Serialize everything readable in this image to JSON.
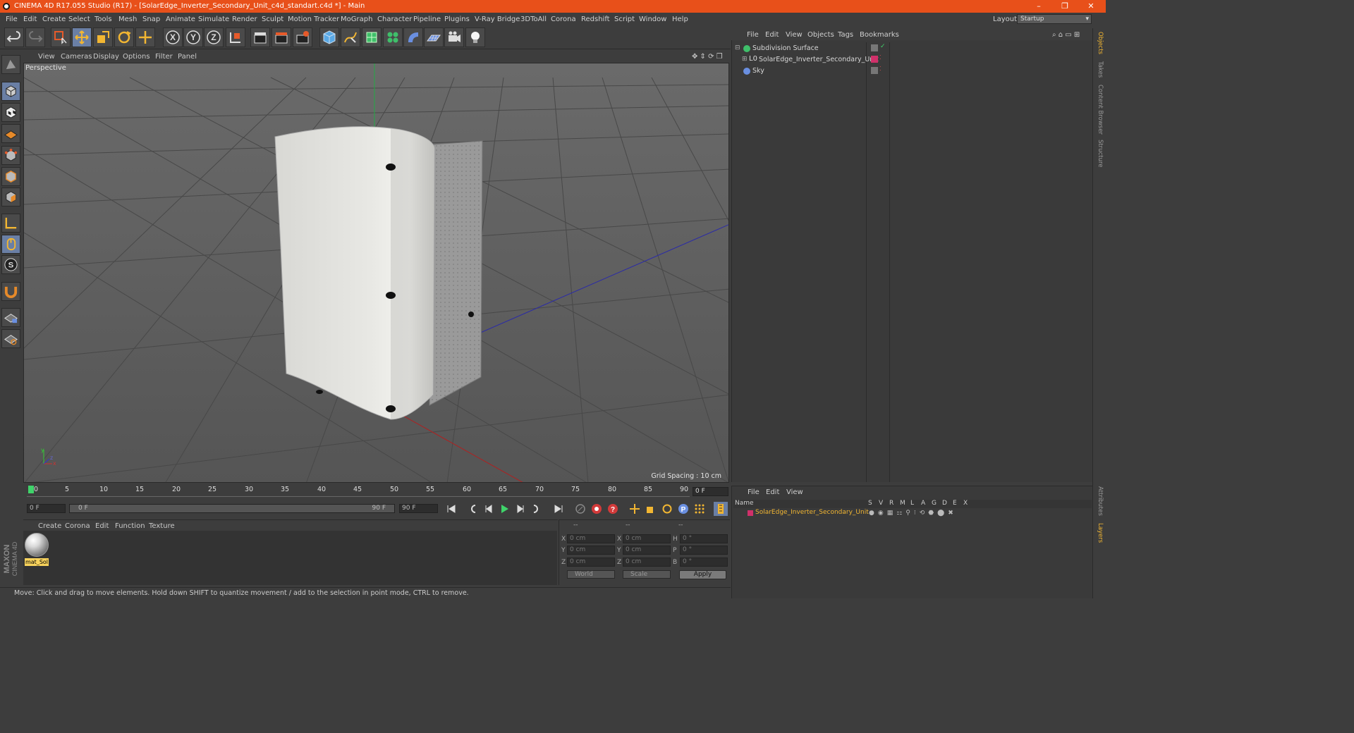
{
  "titlebar": {
    "title": "CINEMA 4D R17.055 Studio (R17) - [SolarEdge_Inverter_Secondary_Unit_c4d_standart.c4d *] - Main",
    "minimize": "–",
    "restore": "❐",
    "close": "✕"
  },
  "menu": [
    "File",
    "Edit",
    "Create",
    "Select",
    "Tools",
    "Mesh",
    "Snap",
    "Animate",
    "Simulate",
    "Render",
    "Sculpt",
    "Motion Tracker",
    "MoGraph",
    "Character",
    "Pipeline",
    "Plugins",
    "V-Ray Bridge",
    "3DToAll",
    "Corona",
    "Redshift",
    "Script",
    "Window",
    "Help"
  ],
  "layout": {
    "label": "Layout:",
    "value": "Startup"
  },
  "viewport": {
    "menu": [
      "View",
      "Cameras",
      "Display",
      "Options",
      "Filter",
      "Panel"
    ],
    "label": "Perspective",
    "grid_spacing": "Grid Spacing : 10 cm",
    "axis_x": "x",
    "axis_y": "y",
    "axis_z": "z"
  },
  "timeline": {
    "ticks": [
      "0",
      "5",
      "10",
      "15",
      "20",
      "25",
      "30",
      "35",
      "40",
      "45",
      "50",
      "55",
      "60",
      "65",
      "70",
      "75",
      "80",
      "85",
      "90"
    ],
    "current_frame": "0 F",
    "start_field": "0 F",
    "range_start": "0 F",
    "range_end": "90 F",
    "end_field": "90 F"
  },
  "material_manager": {
    "menu": [
      "Create",
      "Corona",
      "Edit",
      "Function",
      "Texture"
    ],
    "material_name": "mat_Sol",
    "brand_line1": "MAXON",
    "brand_line2": "CINEMA 4D"
  },
  "coordinates": {
    "headers": [
      "--",
      "--",
      "--"
    ],
    "rows": [
      {
        "l1": "X",
        "v1": "0 cm",
        "l2": "X",
        "v2": "0 cm",
        "l3": "H",
        "v3": "0 °"
      },
      {
        "l1": "Y",
        "v1": "0 cm",
        "l2": "Y",
        "v2": "0 cm",
        "l3": "P",
        "v3": "0 °"
      },
      {
        "l1": "Z",
        "v1": "0 cm",
        "l2": "Z",
        "v2": "0 cm",
        "l3": "B",
        "v3": "0 °"
      }
    ],
    "mode": "World",
    "transform": "Scale",
    "apply": "Apply"
  },
  "status": "Move: Click and drag to move elements. Hold down SHIFT to quantize movement / add to the selection in point mode, CTRL to remove.",
  "objects": {
    "menu": [
      "File",
      "Edit",
      "View",
      "Objects",
      "Tags",
      "Bookmarks"
    ],
    "items": [
      {
        "name": "Subdivision Surface"
      },
      {
        "name": "SolarEdge_Inverter_Secondary_Unit"
      },
      {
        "name": "Sky"
      }
    ]
  },
  "layers": {
    "menu": [
      "File",
      "Edit",
      "View"
    ],
    "columns": [
      "Name",
      "S",
      "V",
      "R",
      "M",
      "L",
      "A",
      "G",
      "D",
      "E",
      "X"
    ],
    "row_name": "SolarEdge_Inverter_Secondary_Unit"
  },
  "right_tabs": [
    "Objects",
    "Takes",
    "Content Browser",
    "Structure",
    "Attributes",
    "Layers"
  ],
  "colors": {
    "titlebar": "#e8501a",
    "accent": "#f2b632",
    "layer": "#d0306a"
  }
}
